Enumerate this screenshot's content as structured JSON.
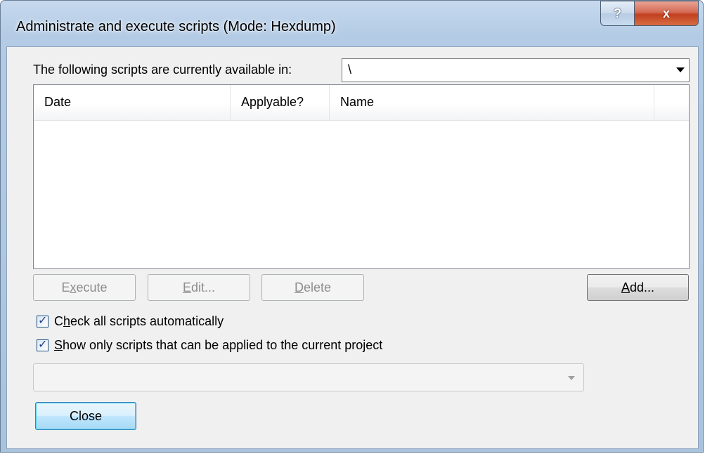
{
  "window": {
    "title": "Administrate and execute scripts (Mode: Hexdump)",
    "help_glyph": "?",
    "close_glyph": "x"
  },
  "location": {
    "label": "The following scripts are currently available in:",
    "value": "\\"
  },
  "table": {
    "columns": [
      "Date",
      "Applyable?",
      "Name"
    ],
    "rows": []
  },
  "buttons": {
    "execute": {
      "before": "E",
      "mnemonic": "x",
      "after": "ecute"
    },
    "edit": {
      "before": "",
      "mnemonic": "E",
      "after": "dit..."
    },
    "delete": {
      "before": "",
      "mnemonic": "D",
      "after": "elete"
    },
    "add": {
      "before": "",
      "mnemonic": "A",
      "after": "dd..."
    },
    "close": "Close"
  },
  "options": {
    "check_all": {
      "before": "C",
      "mnemonic": "h",
      "after": "eck all scripts automatically",
      "checked": true
    },
    "show_only": {
      "before": "",
      "mnemonic": "S",
      "after": "how only scripts that can be applied to the current project",
      "checked": true
    }
  },
  "colors": {
    "dialog_bg": "#f0f0f0",
    "frame": "#a9c3df",
    "close_button": "#c1401f",
    "default_button": "#bee6fd"
  }
}
